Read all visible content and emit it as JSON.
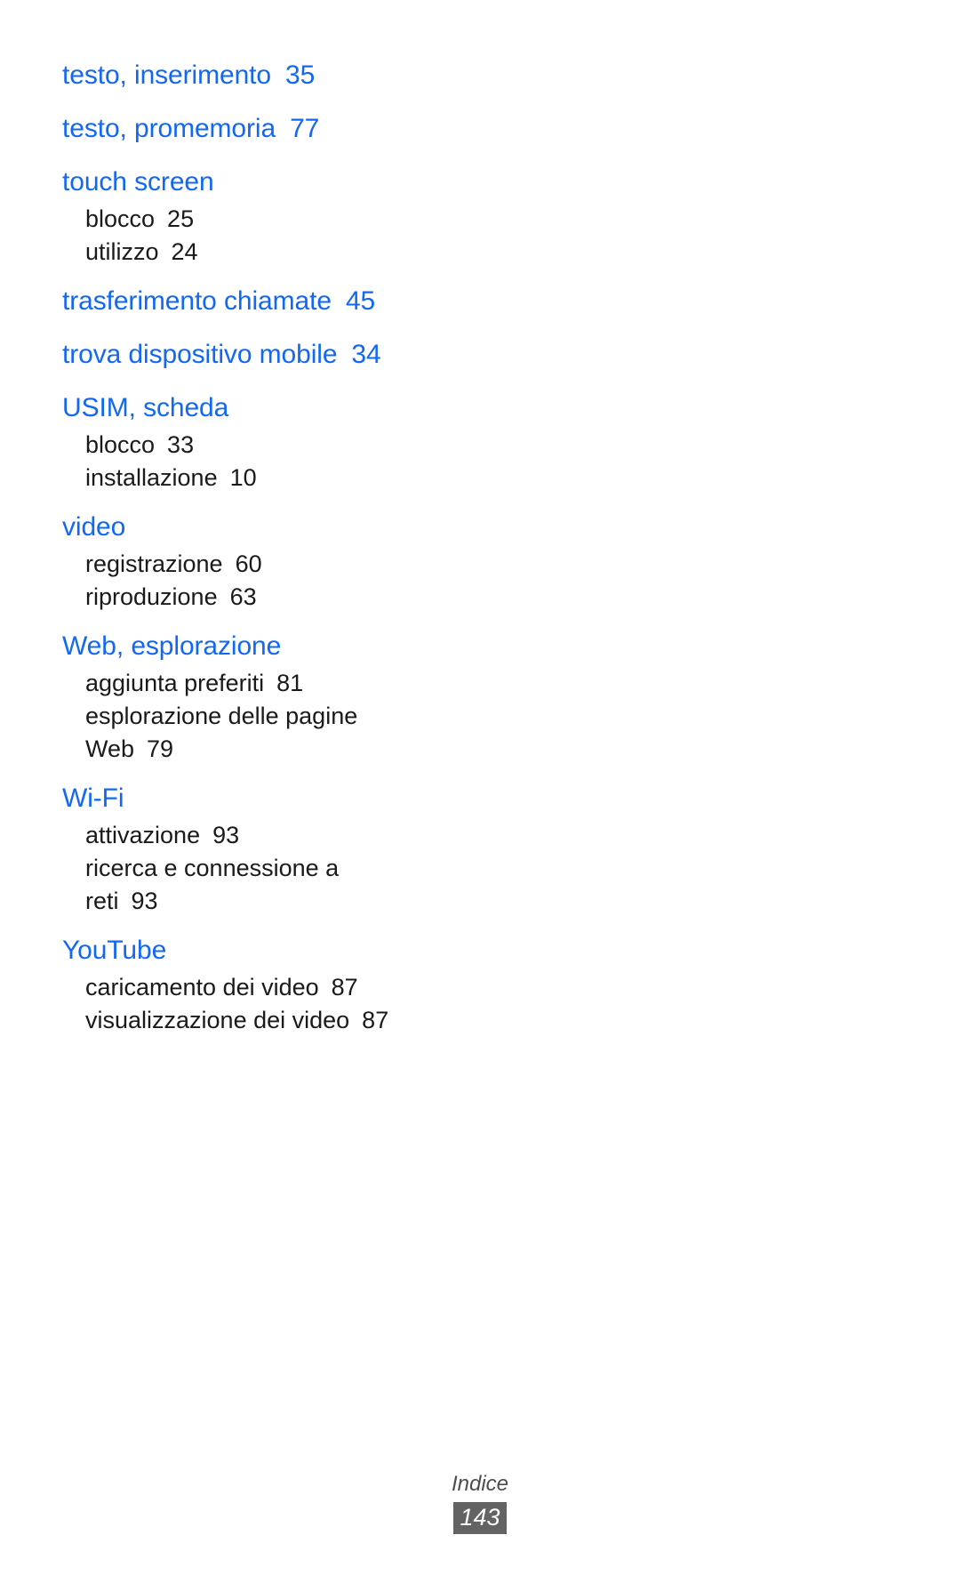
{
  "document": {
    "type": "index-page",
    "language": "it",
    "colors": {
      "heading_blue": "#1268F3",
      "body_black": "#1a1a1a",
      "footer_gray": "#4d4d4d",
      "badge_background": "#636363",
      "badge_text": "#ffffff",
      "page_background": "#ffffff"
    }
  },
  "index": {
    "groups": [
      {
        "heading": "testo, inserimento",
        "heading_page": "35",
        "sub_entries": []
      },
      {
        "heading": "testo, promemoria",
        "heading_page": "77",
        "sub_entries": []
      },
      {
        "heading": "touch screen",
        "heading_page": "",
        "sub_entries": [
          {
            "label": "blocco",
            "page": "25"
          },
          {
            "label": "utilizzo",
            "page": "24"
          }
        ]
      },
      {
        "heading": "trasferimento chiamate",
        "heading_page": "45",
        "sub_entries": []
      },
      {
        "heading": "trova dispositivo mobile",
        "heading_page": "34",
        "sub_entries": []
      },
      {
        "heading": "USIM, scheda",
        "heading_page": "",
        "sub_entries": [
          {
            "label": "blocco",
            "page": "33"
          },
          {
            "label": "installazione",
            "page": "10"
          }
        ]
      },
      {
        "heading": "video",
        "heading_page": "",
        "sub_entries": [
          {
            "label": "registrazione",
            "page": "60"
          },
          {
            "label": "riproduzione",
            "page": "63"
          }
        ]
      },
      {
        "heading": "Web, esplorazione",
        "heading_page": "",
        "sub_entries": [
          {
            "label": "aggiunta preferiti",
            "page": "81"
          },
          {
            "label": "esplorazione delle pagine Web",
            "page": "79"
          }
        ]
      },
      {
        "heading": "Wi-Fi",
        "heading_page": "",
        "sub_entries": [
          {
            "label": "attivazione",
            "page": "93"
          },
          {
            "label": "ricerca e connessione a reti",
            "page": "93"
          }
        ]
      },
      {
        "heading": "YouTube",
        "heading_page": "",
        "sub_entries": [
          {
            "label": "caricamento dei video",
            "page": "87"
          },
          {
            "label": "visualizzazione dei video",
            "page": "87"
          }
        ]
      }
    ]
  },
  "footer": {
    "section_label": "Indice",
    "page_number": "143"
  }
}
